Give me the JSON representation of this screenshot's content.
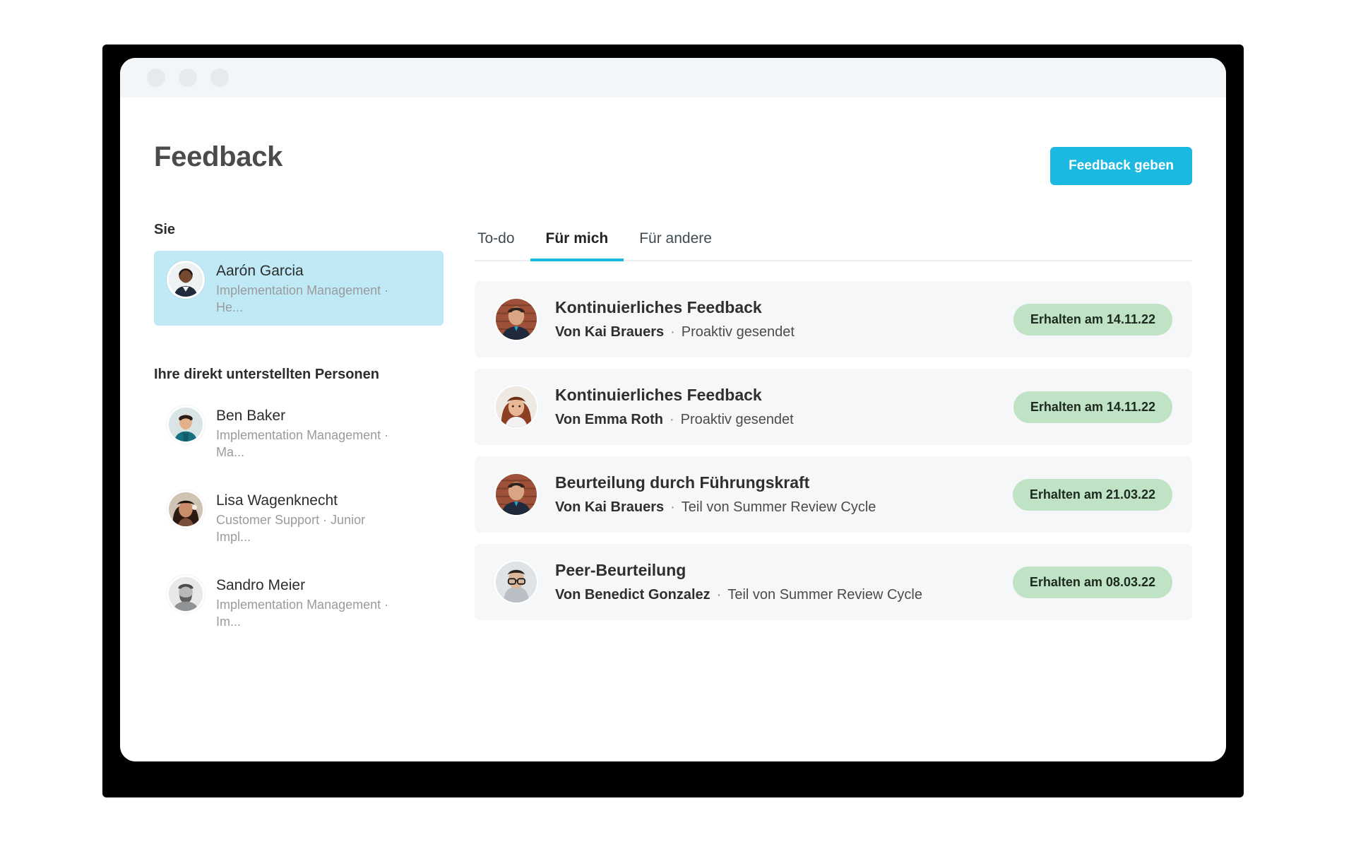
{
  "window": {
    "dots": [
      "close-dot",
      "minimize-dot",
      "maximize-dot"
    ]
  },
  "header": {
    "title": "Feedback",
    "primary_button": "Feedback geben"
  },
  "sidebar": {
    "self_heading": "Sie",
    "self": {
      "name": "Aarón Garcia",
      "role": "Implementation Management · He..."
    },
    "reports_heading": "Ihre direkt unterstellten Personen",
    "reports": [
      {
        "name": "Ben Baker",
        "role": "Implementation Management · Ma..."
      },
      {
        "name": "Lisa Wagenknecht",
        "role": "Customer Support · Junior Impl..."
      },
      {
        "name": "Sandro Meier",
        "role": "Implementation Management · Im..."
      }
    ]
  },
  "main": {
    "tabs": [
      {
        "label": "To-do",
        "active": false
      },
      {
        "label": "Für mich",
        "active": true
      },
      {
        "label": "Für andere",
        "active": false
      }
    ],
    "feedback_items": [
      {
        "title": "Kontinuierliches Feedback",
        "from": "Von Kai Brauers",
        "separator": "·",
        "context": "Proaktiv gesendet",
        "badge": "Erhalten am 14.11.22"
      },
      {
        "title": "Kontinuierliches Feedback",
        "from": "Von Emma Roth",
        "separator": "·",
        "context": "Proaktiv gesendet",
        "badge": "Erhalten am 14.11.22"
      },
      {
        "title": "Beurteilung durch Führungskraft",
        "from": "Von Kai Brauers",
        "separator": "·",
        "context": "Teil von Summer Review Cycle",
        "badge": "Erhalten am 21.03.22"
      },
      {
        "title": "Peer-Beurteilung",
        "from": "Von Benedict Gonzalez",
        "separator": "·",
        "context": "Teil von Summer Review Cycle",
        "badge": "Erhalten am 08.03.22"
      }
    ]
  },
  "colors": {
    "accent": "#1bb8e0",
    "selected_row": "#bfe9f5",
    "badge_green": "#bfe3c4",
    "card_bg": "#f6f7f8",
    "titlebar": "#f2f6f9"
  }
}
